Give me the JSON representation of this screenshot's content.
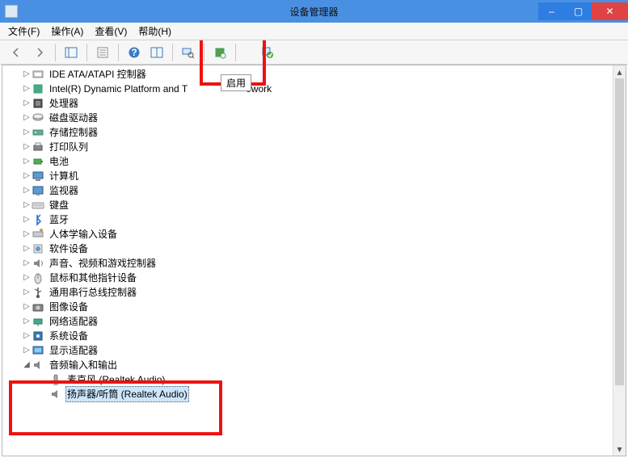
{
  "window": {
    "title": "设备管理器",
    "minimize": "–",
    "maximize": "▢",
    "close": "✕"
  },
  "menu": {
    "file": "文件(F)",
    "action": "操作(A)",
    "view": "查看(V)",
    "help": "帮助(H)"
  },
  "toolbar": {
    "tooltip_enable": "启用"
  },
  "tree": {
    "items": [
      {
        "label": "IDE ATA/ATAPI 控制器",
        "icon": "ide",
        "exp": "▷"
      },
      {
        "label": "Intel(R) Dynamic Platform and T",
        "label_suffix": "ework",
        "icon": "intel",
        "exp": "▷"
      },
      {
        "label": "处理器",
        "icon": "cpu",
        "exp": "▷"
      },
      {
        "label": "磁盘驱动器",
        "icon": "disk",
        "exp": "▷"
      },
      {
        "label": "存储控制器",
        "icon": "storage",
        "exp": "▷"
      },
      {
        "label": "打印队列",
        "icon": "printer",
        "exp": "▷"
      },
      {
        "label": "电池",
        "icon": "battery",
        "exp": "▷"
      },
      {
        "label": "计算机",
        "icon": "computer",
        "exp": "▷"
      },
      {
        "label": "监视器",
        "icon": "monitor",
        "exp": "▷"
      },
      {
        "label": "键盘",
        "icon": "keyboard",
        "exp": "▷"
      },
      {
        "label": "蓝牙",
        "icon": "bluetooth",
        "exp": "▷"
      },
      {
        "label": "人体学输入设备",
        "icon": "hid",
        "exp": "▷"
      },
      {
        "label": "软件设备",
        "icon": "software",
        "exp": "▷"
      },
      {
        "label": "声音、视频和游戏控制器",
        "icon": "sound-ctrl",
        "exp": "▷"
      },
      {
        "label": "鼠标和其他指针设备",
        "icon": "mouse",
        "exp": "▷"
      },
      {
        "label": "通用串行总线控制器",
        "icon": "usb",
        "exp": "▷"
      },
      {
        "label": "图像设备",
        "icon": "camera",
        "exp": "▷"
      },
      {
        "label": "网络适配器",
        "icon": "network",
        "exp": "▷"
      },
      {
        "label": "系统设备",
        "icon": "system",
        "exp": "▷"
      },
      {
        "label": "显示适配器",
        "icon": "display",
        "exp": "▷"
      }
    ],
    "audio_category": {
      "label": "音频输入和输出",
      "exp": "◢"
    },
    "audio_mic": "麦克风 (Realtek Audio)",
    "audio_speaker": "扬声器/听筒 (Realtek Audio)"
  }
}
